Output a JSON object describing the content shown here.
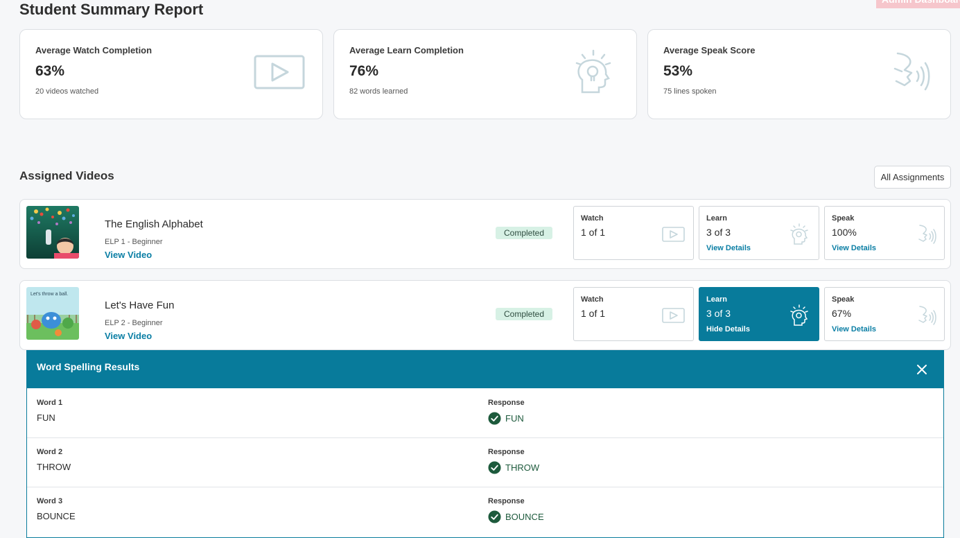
{
  "page": {
    "title": "Student Summary Report",
    "admin_tag": "Admin Dashboard"
  },
  "stats": [
    {
      "label": "Average Watch Completion",
      "value": "63%",
      "sub": "20 videos watched",
      "icon": "play-icon"
    },
    {
      "label": "Average Learn Completion",
      "value": "76%",
      "sub": "82 words learned",
      "icon": "lightbulb-head-icon"
    },
    {
      "label": "Average Speak Score",
      "value": "53%",
      "sub": "75 lines spoken",
      "icon": "speaking-head-icon"
    }
  ],
  "assigned": {
    "title": "Assigned Videos",
    "all_button": "All Assignments"
  },
  "videos": [
    {
      "title": "The English Alphabet",
      "level": "ELP 1 - Beginner",
      "link": "View Video",
      "status": "Completed",
      "watch": {
        "label": "Watch",
        "value": "1 of 1"
      },
      "learn": {
        "label": "Learn",
        "value": "3 of 3",
        "link": "View Details"
      },
      "speak": {
        "label": "Speak",
        "value": "100%",
        "link": "View Details"
      }
    },
    {
      "title": "Let's Have Fun",
      "level": "ELP 2 - Beginner",
      "link": "View Video",
      "status": "Completed",
      "thumb_caption": "Let's throw a ball.",
      "watch": {
        "label": "Watch",
        "value": "1 of 1"
      },
      "learn": {
        "label": "Learn",
        "value": "3 of 3",
        "link": "Hide Details"
      },
      "speak": {
        "label": "Speak",
        "value": "67%",
        "link": "View Details"
      }
    }
  ],
  "spelling": {
    "title": "Word Spelling Results",
    "response_label": "Response",
    "rows": [
      {
        "word_label": "Word 1",
        "word": "FUN",
        "response": "FUN"
      },
      {
        "word_label": "Word 2",
        "word": "THROW",
        "response": "THROW"
      },
      {
        "word_label": "Word 3",
        "word": "BOUNCE",
        "response": "BOUNCE"
      }
    ]
  },
  "colors": {
    "accent": "#087b9b",
    "link": "#0a7ea4",
    "badge_bg": "#d7f1e5",
    "check": "#1d5a3c"
  }
}
